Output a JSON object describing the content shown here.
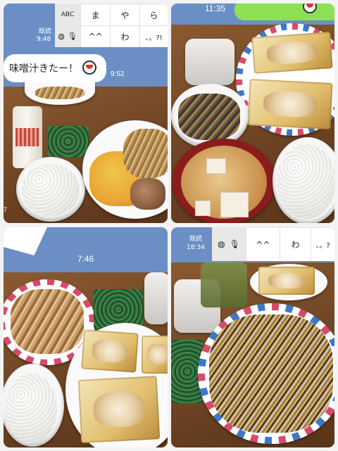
{
  "panel1": {
    "read_label": "既読",
    "read_time": "9:48",
    "keyboard": {
      "mode_label": "ABC",
      "globe_icon": "globe-icon",
      "mic_icon": "mic-icon",
      "row1": [
        "ま",
        "や",
        "ら"
      ],
      "row2": [
        "^^",
        "わ",
        "、。?!"
      ]
    },
    "message_text": "味噌汁きたー！",
    "message_time": "9:52",
    "side_time": "7"
  },
  "panel2": {
    "status_time": "11:35"
  },
  "panel3": {
    "status_time": "7:46"
  },
  "panel4": {
    "read_label": "既読",
    "read_time": "18:34",
    "keyboard": {
      "row2": [
        "^^",
        "わ",
        "、。?"
      ]
    }
  }
}
